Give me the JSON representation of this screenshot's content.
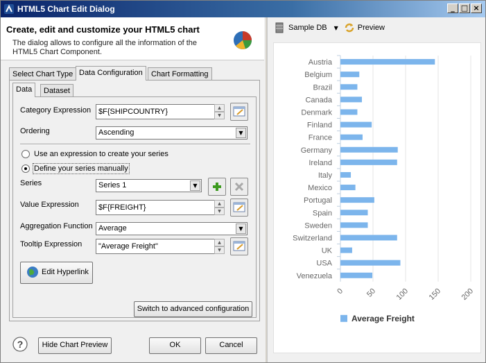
{
  "window": {
    "title": "HTML5 Chart Edit Dialog"
  },
  "header": {
    "title": "Create, edit and customize your HTML5 chart",
    "description": "The dialog allows to configure all the information of the HTML5 Chart Component."
  },
  "tabs": {
    "main": [
      "Select Chart Type",
      "Data Configuration",
      "Chart Formatting"
    ],
    "sub": [
      "Data",
      "Dataset"
    ]
  },
  "form": {
    "category_label": "Category Expression",
    "category_value": "$F{SHIPCOUNTRY}",
    "ordering_label": "Ordering",
    "ordering_value": "Ascending",
    "radio_expression": "Use an expression to create your series",
    "radio_manual": "Define your series manually",
    "series_label": "Series",
    "series_value": "Series 1",
    "value_label": "Value Expression",
    "value_value": "$F{FREIGHT}",
    "aggregation_label": "Aggregation Function",
    "aggregation_value": "Average",
    "tooltip_label": "Tooltip Expression",
    "tooltip_value": "\"Average Freight\"",
    "hyperlink_button": "Edit Hyperlink",
    "advanced_button": "Switch to advanced configuration"
  },
  "footer": {
    "hide_preview": "Hide Chart Preview",
    "ok": "OK",
    "cancel": "Cancel"
  },
  "preview": {
    "source": "Sample DB",
    "preview_label": "Preview"
  },
  "colors": {
    "bar": "#7cb5ec",
    "accent": "#0a246a"
  },
  "chart_data": {
    "type": "bar",
    "orientation": "horizontal",
    "categories": [
      "Austria",
      "Belgium",
      "Brazil",
      "Canada",
      "Denmark",
      "Finland",
      "France",
      "Germany",
      "Ireland",
      "Italy",
      "Mexico",
      "Portugal",
      "Spain",
      "Sweden",
      "Switzerland",
      "UK",
      "USA",
      "Venezuela"
    ],
    "series": [
      {
        "name": "Average Freight",
        "values": [
          145,
          29,
          26,
          33,
          26,
          48,
          34,
          88,
          87,
          16,
          23,
          52,
          42,
          42,
          87,
          18,
          92,
          49
        ]
      }
    ],
    "xlim": [
      0,
      200
    ],
    "xticks": [
      "0",
      "50",
      "100",
      "150",
      "200"
    ],
    "grid": true,
    "legend": "bottom"
  }
}
